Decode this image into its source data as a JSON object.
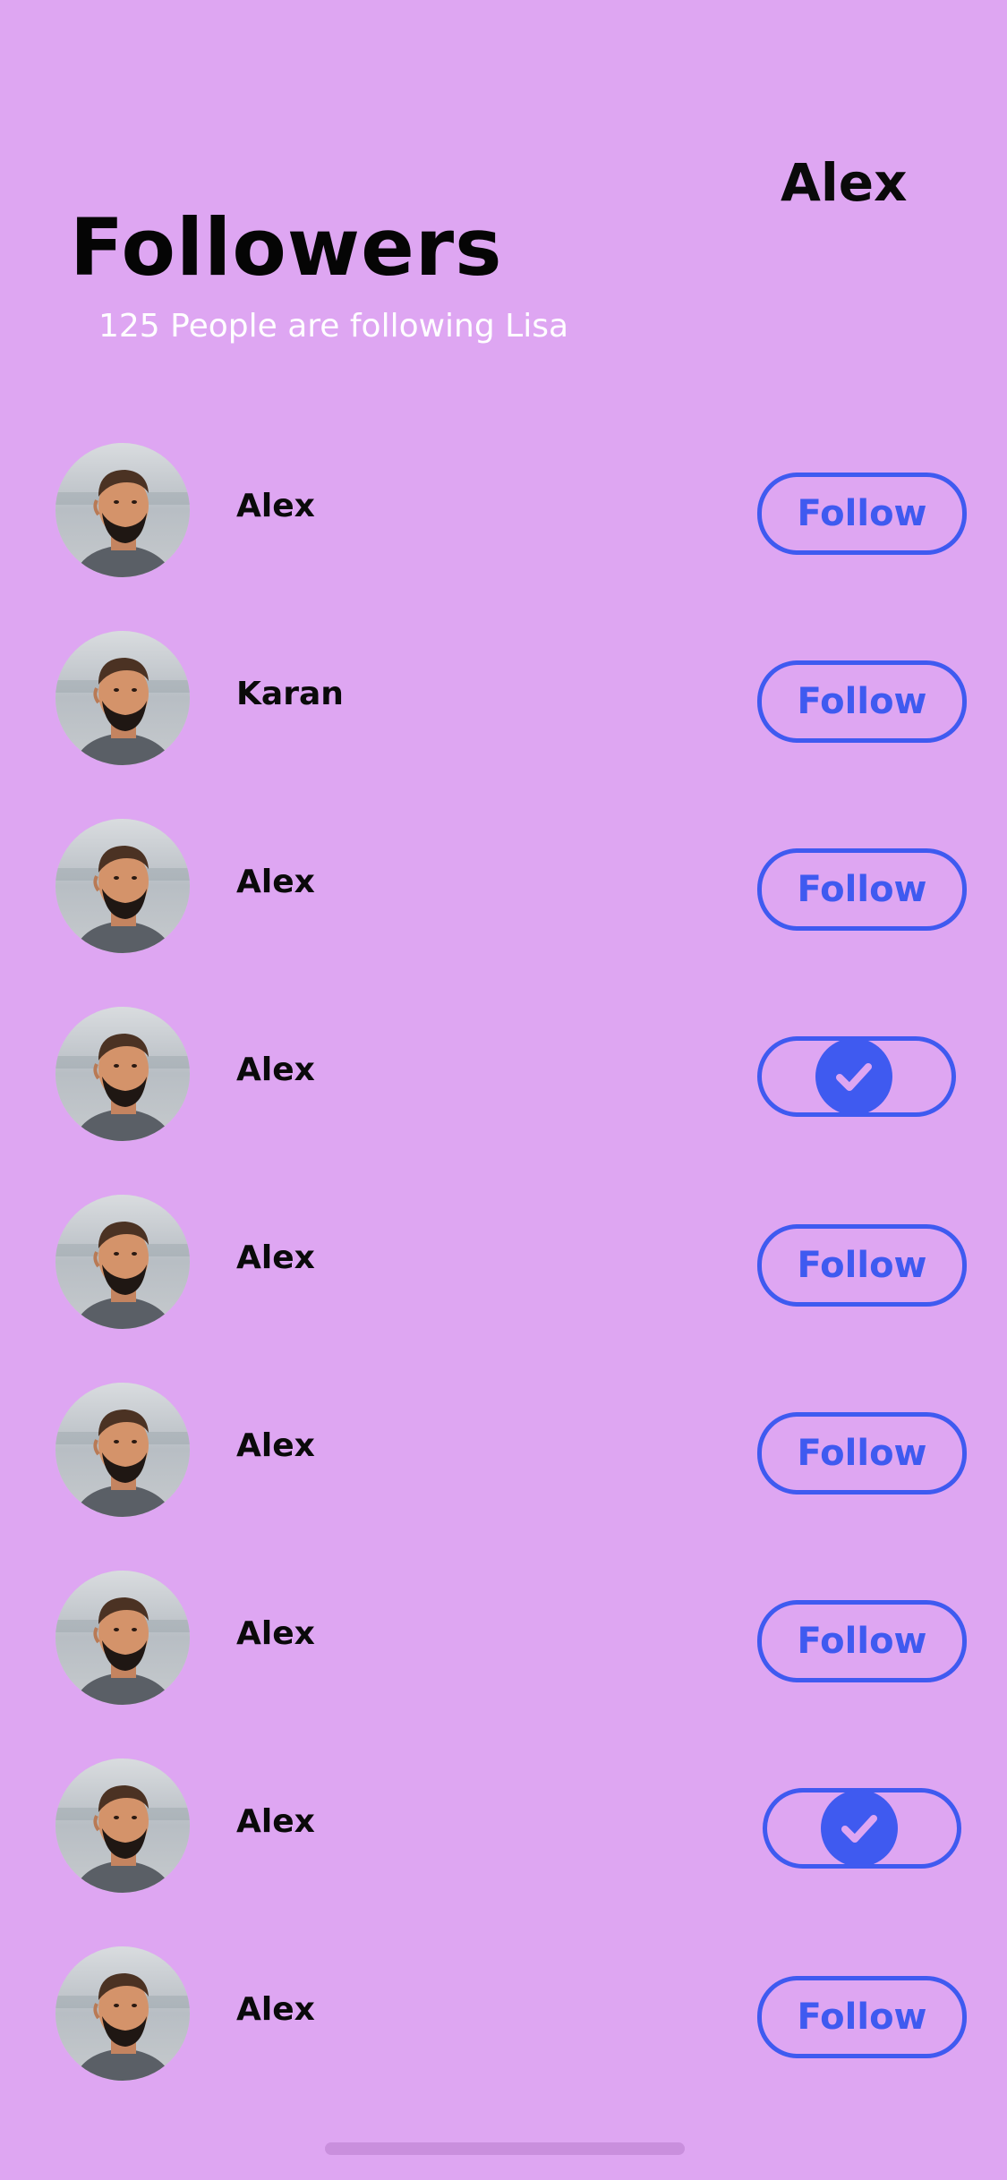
{
  "header": {
    "current_user": "Alex",
    "title": "Followers",
    "subtitle": "125 People are following Lisa"
  },
  "colors": {
    "background": "#dea6f2",
    "accent": "#3f5af0",
    "title_text": "#050505",
    "subtitle_text": "#ffffff"
  },
  "followers": [
    {
      "name": "Alex",
      "following": false,
      "button_label": "Follow"
    },
    {
      "name": "Karan",
      "following": false,
      "button_label": "Follow"
    },
    {
      "name": "Alex",
      "following": false,
      "button_label": "Follow"
    },
    {
      "name": "Alex",
      "following": true,
      "button_label": ""
    },
    {
      "name": "Alex",
      "following": false,
      "button_label": "Follow"
    },
    {
      "name": "Alex",
      "following": false,
      "button_label": "Follow"
    },
    {
      "name": "Alex",
      "following": false,
      "button_label": "Follow"
    },
    {
      "name": "Alex",
      "following": true,
      "button_label": ""
    },
    {
      "name": "Alex",
      "following": false,
      "button_label": "Follow"
    }
  ],
  "icons": {
    "following_toggle": "check-icon",
    "avatar": "avatar-photo"
  }
}
